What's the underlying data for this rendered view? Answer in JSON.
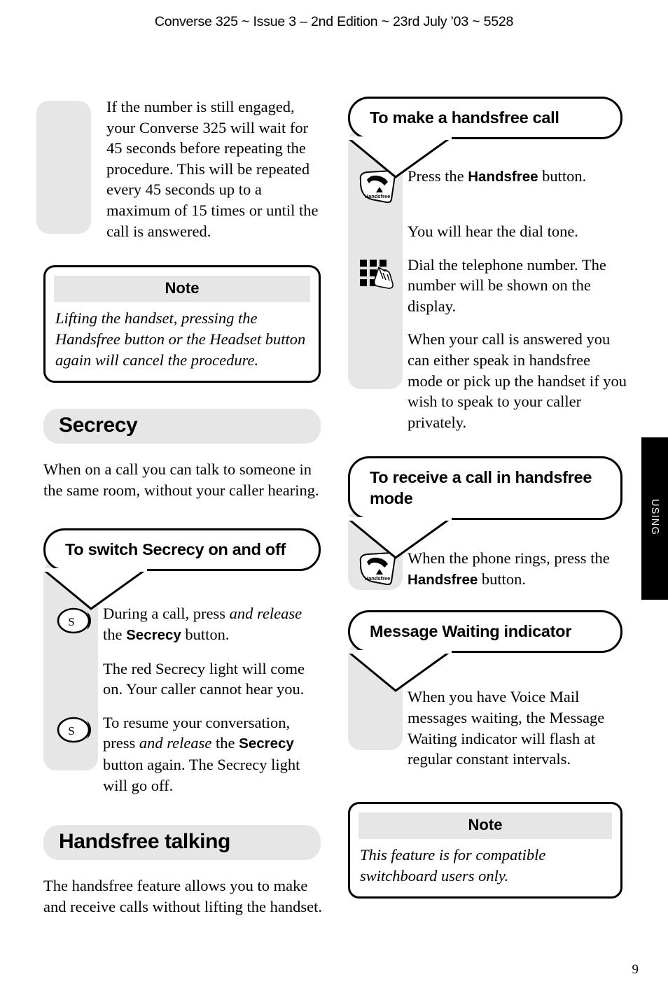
{
  "header": {
    "running_head": "Converse 325 ~ Issue 3 – 2nd Edition ~ 23rd July ’03 ~ 5528"
  },
  "side_tab": {
    "label": "USING"
  },
  "page_number": "9",
  "left_column": {
    "continued_paragraph": "If the number is still engaged, your Converse 325 will wait for 45 seconds before repeating the procedure. This will be repeated every 45 seconds up to a maximum of 15 times or until the call is answered.",
    "note": {
      "title": "Note",
      "body": "Lifting the handset, pressing the Handsfree button or the Headset button again will cancel the procedure."
    },
    "secrecy_heading": "Secrecy",
    "secrecy_intro": "When on a call you can talk to someone in the same room, without your caller hearing.",
    "secrecy_callout": "To switch Secrecy on and off",
    "secrecy_steps": [
      {
        "icon": "secrecy-button-icon",
        "text_parts": [
          {
            "t": "During a call, press ",
            "s": "normal"
          },
          {
            "t": "and release",
            "s": "italic"
          },
          {
            "t": " the ",
            "s": "normal"
          },
          {
            "t": "Secrecy",
            "s": "bold"
          },
          {
            "t": " button.",
            "s": "normal"
          }
        ]
      },
      {
        "icon": "none",
        "text_parts": [
          {
            "t": "The red Secrecy light will come on. Your caller cannot hear you.",
            "s": "normal"
          }
        ]
      },
      {
        "icon": "secrecy-button-icon",
        "text_parts": [
          {
            "t": "To resume your conversation, press ",
            "s": "normal"
          },
          {
            "t": "and release",
            "s": "italic"
          },
          {
            "t": " the ",
            "s": "normal"
          },
          {
            "t": "Secrecy",
            "s": "bold"
          },
          {
            "t": " button again. The Secrecy light will go off.",
            "s": "normal"
          }
        ]
      }
    ],
    "handsfree_heading": "Handsfree talking",
    "handsfree_intro": "The handsfree feature allows you to make and receive calls without lifting the handset."
  },
  "right_column": {
    "make_call_callout": "To make a handsfree call",
    "make_call_steps": [
      {
        "icon": "handsfree-button-icon",
        "text_parts": [
          {
            "t": "Press the ",
            "s": "normal"
          },
          {
            "t": "Handsfree",
            "s": "bold"
          },
          {
            "t": " button.",
            "s": "normal"
          }
        ]
      },
      {
        "icon": "none",
        "text_parts": [
          {
            "t": "You will hear the dial tone.",
            "s": "normal"
          }
        ]
      },
      {
        "icon": "keypad-icon",
        "text_parts": [
          {
            "t": "Dial the telephone number. The number will be shown on the display.",
            "s": "normal"
          }
        ]
      },
      {
        "icon": "none",
        "text_parts": [
          {
            "t": "When your call is answered you can either speak in handsfree mode or pick up the handset if you wish to speak to your caller privately.",
            "s": "normal"
          }
        ]
      }
    ],
    "receive_call_callout": "To receive a call in handsfree mode",
    "receive_call_steps": [
      {
        "icon": "handsfree-button-icon",
        "text_parts": [
          {
            "t": "When the phone rings, press the ",
            "s": "normal"
          },
          {
            "t": "Handsfree",
            "s": "bold"
          },
          {
            "t": " button.",
            "s": "normal"
          }
        ]
      }
    ],
    "message_waiting_callout": "Message Waiting indicator",
    "message_waiting_steps": [
      {
        "icon": "none",
        "text_parts": [
          {
            "t": "When you have Voice Mail messages waiting, the Message Waiting indicator will flash at regular constant intervals.",
            "s": "normal"
          }
        ]
      }
    ],
    "note": {
      "title": "Note",
      "body": "This feature is for compatible switchboard users only."
    }
  },
  "icons": {
    "secrecy_button_letter": "S",
    "handsfree_button_label": "Handsfree"
  },
  "colors": {
    "gray_fill": "#e6e6e6",
    "black": "#000000",
    "white": "#ffffff"
  }
}
